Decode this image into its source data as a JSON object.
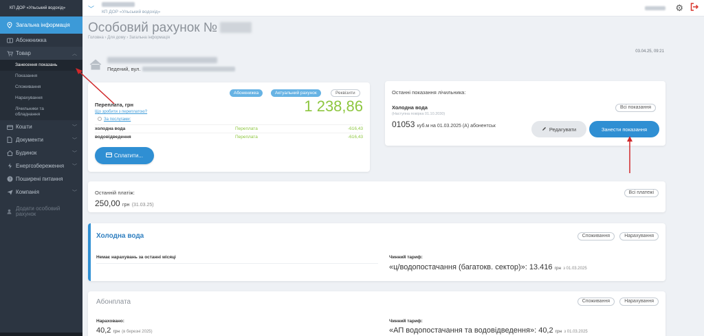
{
  "sidebar": {
    "brand": "КП ДОР «Ульський водохід»",
    "items": [
      {
        "label": "Загальна інформація",
        "icon": "map-pin-icon"
      },
      {
        "label": "Абонкнижка",
        "icon": "book-icon"
      },
      {
        "label": "Товар",
        "icon": "cart-icon"
      },
      {
        "label": "Кошти",
        "icon": "wallet-icon"
      },
      {
        "label": "Документи",
        "icon": "document-icon"
      },
      {
        "label": "Будинок",
        "icon": "house-icon"
      },
      {
        "label": "Енергозбереження",
        "icon": "bolt-icon"
      },
      {
        "label": "Поширені питання",
        "icon": "question-icon"
      },
      {
        "label": "Компанія",
        "icon": "send-icon"
      },
      {
        "label": "Додати особовий рахунок",
        "icon": "add-user-icon"
      }
    ],
    "submenu": [
      "Занесення показань",
      "Показання",
      "Споживання",
      "Нарахування",
      "Лічильники та обладнання"
    ]
  },
  "topbar": {
    "account_line": "КП ДОР «Ульський водохід»"
  },
  "page": {
    "title": "Особовий рахунок №",
    "breadcrumb": "Головна › Для дому › Загальна інформація",
    "timestamp": "03.04.25, 09:21"
  },
  "owner": {
    "address_prefix": "Педений, вул."
  },
  "balance": {
    "tabs": [
      "Абонкнижка",
      "Актуальний рахунок",
      "Реквізити"
    ],
    "label": "Переплата, грн",
    "link": "Що зробити з переплатою?",
    "amount": "1 238,86",
    "services_toggle": "За послугами:",
    "rows": [
      {
        "name": "холодна вода",
        "status": "Переплата",
        "sum": "-616,43"
      },
      {
        "name": "водовідведення",
        "status": "Переплата",
        "sum": "-616,43"
      }
    ],
    "pay_button": "Сплатити..."
  },
  "meter": {
    "title": "Останні показання лічильника:",
    "service": "Холодна вода",
    "verified": "(Наступна повірка 01.10.2030)",
    "reading": "01053",
    "unit_date": "куб.м  на 01.03.2025 (А) абонентськ",
    "all_readings": "Всі показання",
    "edit_button": "Редагувати",
    "enter_button": "Занести показання"
  },
  "last_payment": {
    "label": "Останній платіж:",
    "amount": "250,00",
    "unit": "грн",
    "date": "(31.03.25)",
    "all_button": "Всі платежі"
  },
  "cold_water": {
    "title": "Холодна вода",
    "btn_consumption": "Споживання",
    "btn_charges": "Нарахування",
    "no_charges": "Немає нарахувань за останні місяці",
    "tariff_label": "Чинний тариф:",
    "tariff_value": "«ц/водопостачання (багатокв. сектор)»: 13.416",
    "tariff_unit": "грн",
    "tariff_date": "з 01.03.2025"
  },
  "subscription": {
    "title": "Абонплата",
    "btn_consumption": "Споживання",
    "btn_charges": "Нарахування",
    "charged_label": "Нараховано:",
    "charged_value": "40,2",
    "charged_unit": "грн",
    "charged_period": "(в березні 2025)",
    "tariff_label": "Чинний тариф:",
    "tariff_value": "«АП водопостачання та водовідведення»: 40,2",
    "tariff_unit": "грн",
    "tariff_date": "з 01.03.2025"
  },
  "colors": {
    "accent": "#2f8fd3",
    "positive": "#8dc63f",
    "sidebar_bg": "#2c3541",
    "annotation": "#d0282a"
  }
}
